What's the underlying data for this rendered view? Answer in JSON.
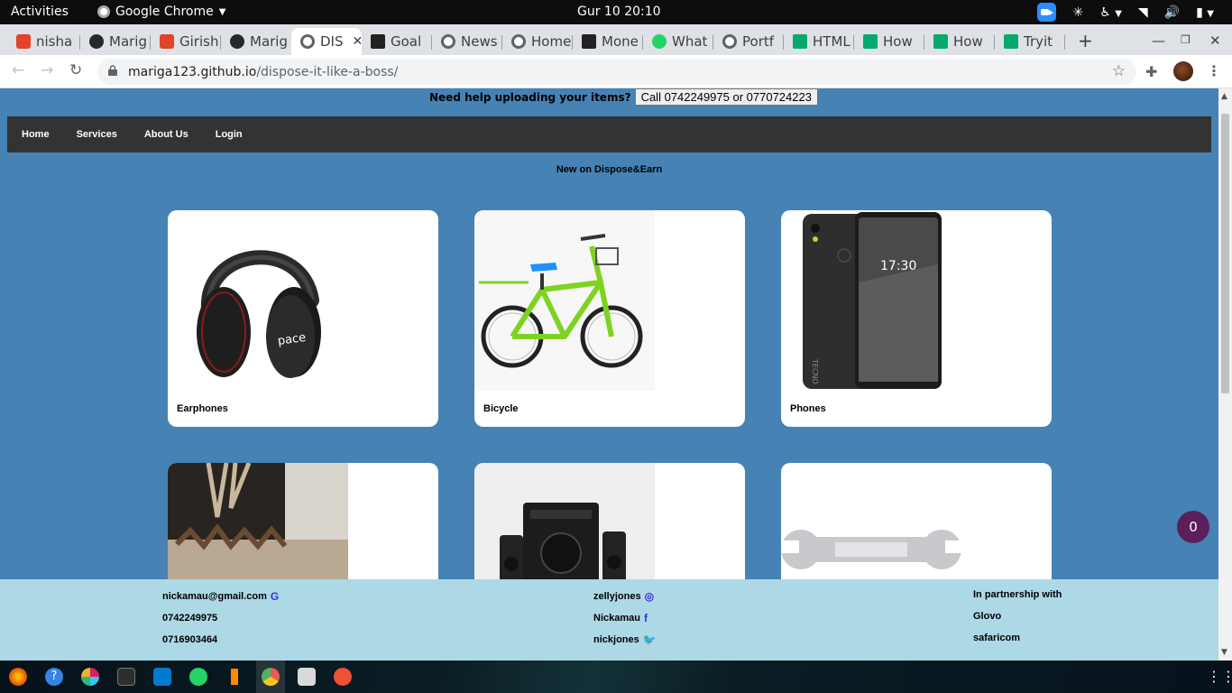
{
  "system": {
    "activities": "Activities",
    "app_name": "Google Chrome",
    "clock": "Gur 10  20:10"
  },
  "browser": {
    "tabs": [
      {
        "label": "nisha",
        "icon": "gitlab-icon"
      },
      {
        "label": "Marig",
        "icon": "github-icon"
      },
      {
        "label": "Girish",
        "icon": "gitlab-icon"
      },
      {
        "label": "Marig",
        "icon": "github-icon"
      },
      {
        "label": "DIS",
        "icon": "globe-icon",
        "active": true
      },
      {
        "label": "Goal",
        "icon": "angular-icon"
      },
      {
        "label": "News",
        "icon": "globe-icon"
      },
      {
        "label": "Home",
        "icon": "globe-icon"
      },
      {
        "label": "Mone",
        "icon": "angular-icon"
      },
      {
        "label": "What",
        "icon": "whatsapp-icon"
      },
      {
        "label": "Portf",
        "icon": "globe-icon"
      },
      {
        "label": "HTML",
        "icon": "w3schools-icon"
      },
      {
        "label": "How",
        "icon": "w3schools-icon"
      },
      {
        "label": "How",
        "icon": "w3schools-icon"
      },
      {
        "label": "Tryit",
        "icon": "w3schools-icon"
      }
    ],
    "url_host": "mariga123.github.io",
    "url_path": "/dispose-it-like-a-boss/"
  },
  "page": {
    "help_text": "Need help uploading your items?",
    "help_button": "Call 0742249975 or 0770724223",
    "nav": [
      "Home",
      "Services",
      "About Us",
      "Login"
    ],
    "subtitle": "New on Dispose&Earn",
    "cards": [
      {
        "label": "Earphones",
        "image": "headphones-image"
      },
      {
        "label": "Bicycle",
        "image": "bicycle-image"
      },
      {
        "label": "Phones",
        "image": "phone-image"
      },
      {
        "label": "",
        "image": "sofa-image"
      },
      {
        "label": "",
        "image": "speaker-image"
      },
      {
        "label": "",
        "image": "wrench-image"
      }
    ],
    "footer": {
      "col1": {
        "email": "nickamau@gmail.com",
        "phone1": "0742249975",
        "phone2": "0716903464"
      },
      "col2": {
        "instagram": "zellyjones",
        "facebook": "Nickamau",
        "twitter": "nickjones"
      },
      "col3": {
        "heading": "In partnership with",
        "partner1": "Glovo",
        "partner2": "safaricom"
      }
    },
    "cart_count": "0"
  }
}
